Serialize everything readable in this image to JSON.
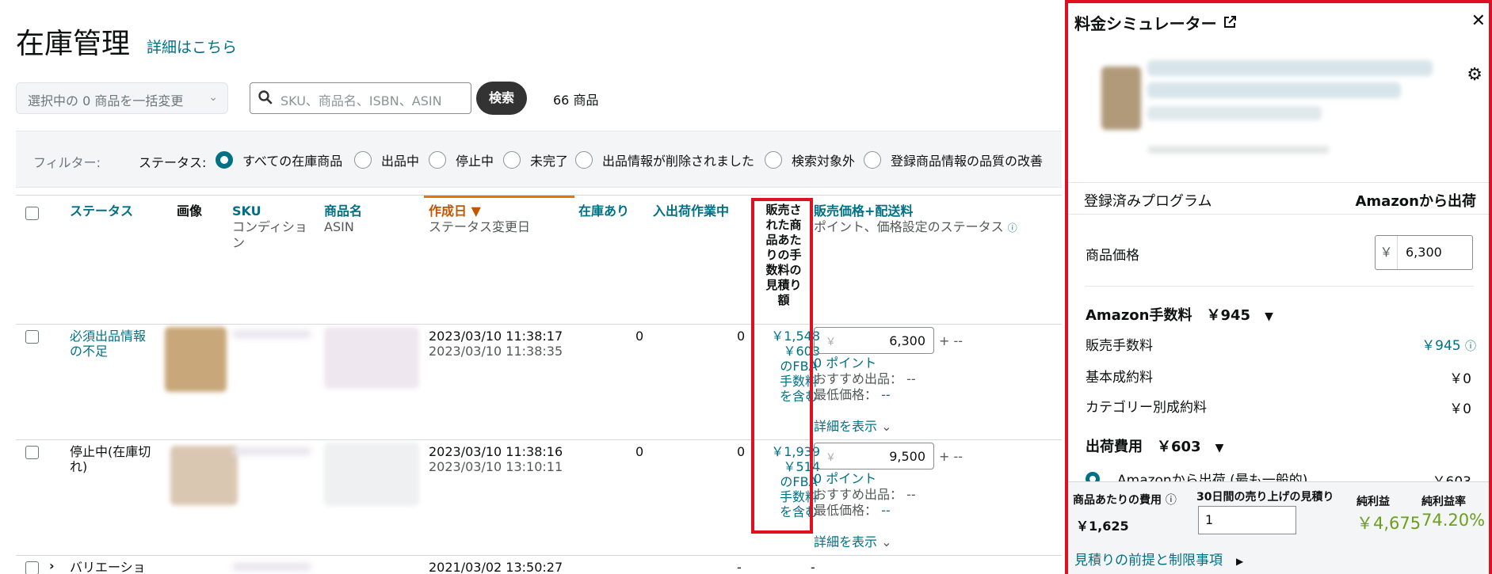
{
  "header": {
    "title": "在庫管理",
    "link": "詳細はこちら"
  },
  "toolbar": {
    "bulk_label": "選択中の 0 商品を一括変更",
    "search_placeholder": "SKU、商品名、ISBN、ASIN",
    "search_button": "検索",
    "count": "66 商品"
  },
  "filter": {
    "label": "フィルター:",
    "status_label": "ステータス:",
    "options": [
      "すべての在庫商品",
      "出品中",
      "停止中",
      "未完了",
      "出品情報が削除されました",
      "検索対象外",
      "登録商品情報の品質の改善"
    ]
  },
  "table": {
    "headers": {
      "status": "ステータス",
      "image": "画像",
      "sku": "SKU",
      "sku_sub": "コンディション",
      "name": "商品名",
      "name_sub": "ASIN",
      "created": "作成日",
      "created_sub": "ステータス変更日",
      "stock": "在庫あり",
      "inbound": "入出荷作業中",
      "fee": "販売された商品あたりの手数料の見積り額",
      "price": "販売価格+配送料",
      "price_sub": "ポイント、価格設定のステータス"
    },
    "rows": [
      {
        "status": "必須出品情報の不足",
        "created": "2023/03/10 11:38:17",
        "changed": "2023/03/10 11:38:35",
        "stock": "0",
        "inbound": "0",
        "fee_total": "￥1,548",
        "fee_fba": "￥603",
        "fee_note": "のFBA手数料を含む",
        "price_yen": "￥",
        "price": "6,300",
        "shipping": "+ --",
        "points": "0 ポイント",
        "recommended": "おすすめ出品： --",
        "lowest_label": "最低価格：",
        "lowest": "--",
        "details": "詳細を表示"
      },
      {
        "status": "停止中(在庫切れ)",
        "created": "2023/03/10 11:38:16",
        "changed": "2023/03/10 13:10:11",
        "stock": "0",
        "inbound": "0",
        "fee_total": "￥1,939",
        "fee_fba": "￥514",
        "fee_note": "のFBA手数料を含む",
        "price_yen": "￥",
        "price": "9,500",
        "shipping": "+ --",
        "points": "0 ポイント",
        "recommended": "おすすめ出品： --",
        "lowest_label": "最低価格：",
        "lowest": "--",
        "details": "詳細を表示"
      },
      {
        "status": "バリエーショ",
        "created": "2021/03/02 13:50:27",
        "stock": "-",
        "inbound": "-"
      }
    ]
  },
  "simulator": {
    "title": "料金シミュレーター",
    "program_label": "登録済みプログラム",
    "program_value": "Amazonから出荷",
    "price_label": "商品価格",
    "price_yen": "￥",
    "price_value": "6,300",
    "amazon_fee_label": "Amazon手数料",
    "amazon_fee_value": "￥945",
    "sales_fee_label": "販売手数料",
    "sales_fee_value": "￥945",
    "basic_fee_label": "基本成約料",
    "basic_fee_value": "￥0",
    "category_fee_label": "カテゴリー別成約料",
    "category_fee_value": "￥0",
    "shipping_label": "出荷費用",
    "shipping_value": "￥603",
    "fba_option": "Amazonから出荷 (最も一般的)",
    "fba_option_value": "￥603",
    "footer": {
      "cost_label": "商品あたりの費用",
      "cost_value": "￥1,625",
      "sales_label": "30日間の売り上げの見積り",
      "sales_value": "1",
      "profit_label": "純利益",
      "profit_value": "￥4,675",
      "margin_label": "純利益率",
      "margin_value": "74.20%",
      "assumptions": "見積りの前提と制限事項"
    }
  },
  "colors": {
    "accent": "#007185",
    "highlight": "#e01020",
    "profit": "#6b9f1c",
    "sort": "#c45500"
  }
}
